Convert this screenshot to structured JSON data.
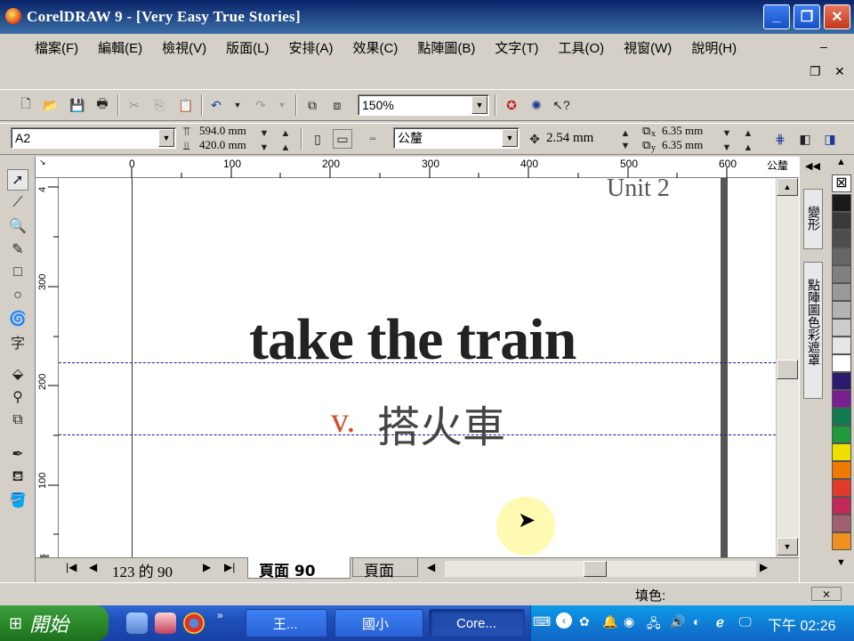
{
  "window": {
    "title": "CorelDRAW 9 - [Very Easy True Stories]",
    "minimize": "_",
    "maximize": "❐",
    "close": "✕"
  },
  "menu": [
    "檔案(F)",
    "編輯(E)",
    "檢視(V)",
    "版面(L)",
    "安排(A)",
    "效果(C)",
    "點陣圖(B)",
    "文字(T)",
    "工具(O)",
    "視窗(W)",
    "說明(H)"
  ],
  "toolbar": {
    "zoom_value": "150%"
  },
  "property_bar": {
    "paper_type": "A2",
    "width": "594.0 mm",
    "height": "420.0 mm",
    "units": "公釐",
    "nudge": "2.54 mm",
    "dup_x": "6.35 mm",
    "dup_y": "6.35 mm",
    "x_label": "x",
    "y_label": "y"
  },
  "rulers": {
    "unit": "公釐",
    "h_ticks": [
      "0",
      "100",
      "200",
      "300",
      "400",
      "500",
      "600"
    ],
    "v_ticks": [
      "4",
      "300",
      "200",
      "100"
    ]
  },
  "canvas": {
    "header_text": "Unit 2",
    "headline": "take the train",
    "pos_label": "v.",
    "translation": "搭火車"
  },
  "pages": {
    "counter": "123 的 90",
    "current_tab": "頁面  90",
    "next_tab": "頁面"
  },
  "docker": {
    "tab1": "變形",
    "tab2": "點陣圖色彩遮罩"
  },
  "palette": [
    "#ffffff",
    "#1a1a1a",
    "#3a3a3a",
    "#4d4d4d",
    "#666666",
    "#808080",
    "#999999",
    "#b3b3b3",
    "#cccccc",
    "#e6e6e6",
    "#ffffff",
    "#2b1a6e",
    "#7a1f8f",
    "#0f7a4f",
    "#1f9a3a",
    "#f0e000",
    "#f07a00",
    "#e03a2a",
    "#c02a5a",
    "#a06070",
    "#f09020"
  ],
  "status": {
    "fill_label": "填色:"
  },
  "taskbar": {
    "start": "開始",
    "tasks": [
      "王...",
      "國小",
      "Core..."
    ],
    "clock": "下午 02:26"
  },
  "colors": {
    "title_bar": "#0a246a",
    "accent_orange": "#d0502a"
  }
}
